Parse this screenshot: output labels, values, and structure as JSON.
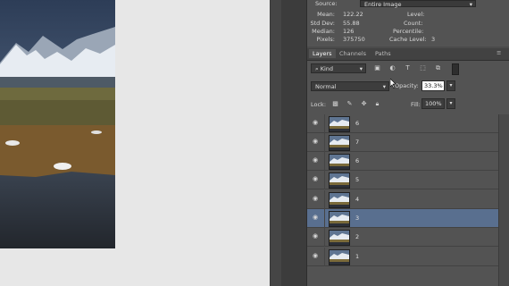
{
  "histogram": {
    "source_label": "Source:",
    "source_value": "Entire Image",
    "stats": [
      {
        "label": "Mean:",
        "value": "122.22"
      },
      {
        "label": "Std Dev:",
        "value": "55.88"
      },
      {
        "label": "Median:",
        "value": "126"
      },
      {
        "label": "Pixels:",
        "value": "375750"
      }
    ],
    "right_stats": [
      {
        "label": "Level:",
        "value": ""
      },
      {
        "label": "Count:",
        "value": ""
      },
      {
        "label": "Percentile:",
        "value": ""
      },
      {
        "label": "Cache Level:",
        "value": "3"
      }
    ]
  },
  "layers_panel": {
    "tabs": [
      "Layers",
      "Channels",
      "Paths"
    ],
    "active_tab": "Layers",
    "filter_kind": "Kind",
    "blend_mode": "Normal",
    "opacity_label": "Opacity:",
    "opacity_value": "33.3%",
    "lock_label": "Lock:",
    "fill_label": "Fill:",
    "fill_value": "100%",
    "layers": [
      {
        "name": "6",
        "selected": false
      },
      {
        "name": "7",
        "selected": false
      },
      {
        "name": "6",
        "selected": false
      },
      {
        "name": "5",
        "selected": false
      },
      {
        "name": "4",
        "selected": false
      },
      {
        "name": "3",
        "selected": true
      },
      {
        "name": "2",
        "selected": false
      },
      {
        "name": "1",
        "selected": false
      }
    ]
  },
  "colors": {
    "selected_row": "#596f8f",
    "panel_bg": "#535353"
  }
}
